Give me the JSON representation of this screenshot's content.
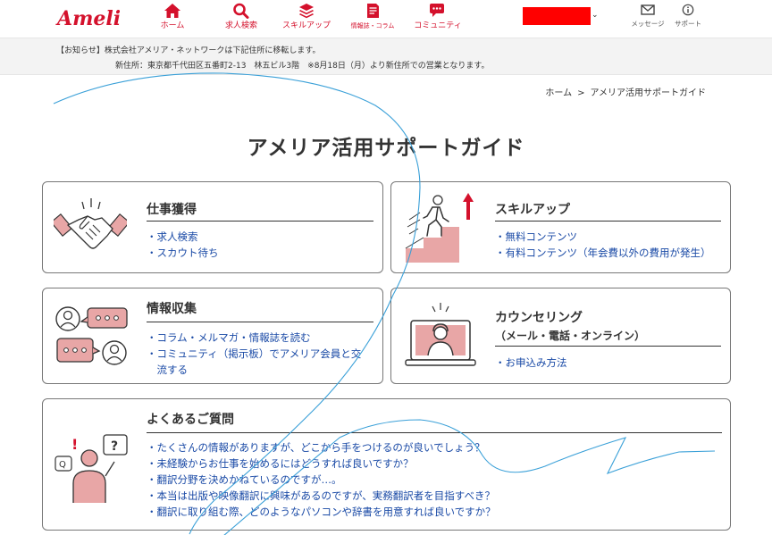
{
  "header": {
    "logo_text": "Amelia",
    "nav": [
      {
        "label": "ホーム",
        "icon": "home-icon"
      },
      {
        "label": "求人検索",
        "icon": "search-icon"
      },
      {
        "label": "スキルアップ",
        "icon": "layers-icon"
      },
      {
        "label": "情報誌・コラム",
        "icon": "document-icon"
      },
      {
        "label": "コミュニティ",
        "icon": "chat-icon"
      }
    ],
    "util": [
      {
        "label": "メッセージ",
        "icon": "envelope-icon"
      },
      {
        "label": "サポート",
        "icon": "info-icon"
      }
    ],
    "user_chevron": "⌄"
  },
  "notice": {
    "line1": "【お知らせ】株式会社アメリア・ネットワークは下記住所に移転します。",
    "line2": "新住所：東京都千代田区五番町2-13　林五ビル3階　※8月18日（月）より新住所での営業となります。"
  },
  "breadcrumb": {
    "home": "ホーム",
    "sep": ">",
    "current": "アメリア活用サポートガイド"
  },
  "page_title": "アメリア活用サポートガイド",
  "cards": {
    "job": {
      "heading": "仕事獲得",
      "icon": "handshake-icon",
      "links": [
        "・求人検索",
        "・スカウト待ち"
      ]
    },
    "skill": {
      "heading": "スキルアップ",
      "icon": "stairs-climb-icon",
      "links": [
        "・無料コンテンツ",
        "・有料コンテンツ（年会費以外の費用が発生）"
      ]
    },
    "info": {
      "heading": "情報収集",
      "icon": "conversation-icon",
      "links": [
        "・コラム・メルマガ・情報誌を読む",
        "・コミュニティ（掲示板）でアメリア会員と交",
        "　流する"
      ]
    },
    "counsel": {
      "heading": "カウンセリング",
      "sub": "（メール・電話・オンライン）",
      "icon": "online-counseling-icon",
      "links": [
        "・お申込み方法"
      ]
    },
    "faq": {
      "heading": "よくあるご質問",
      "icon": "question-person-icon",
      "links": [
        "・たくさんの情報がありますが、どこから手をつけるのが良いでしょう？",
        "・未経験からお仕事を始めるにはどうすれば良いですか？",
        "・翻訳分野を決めかねているのですが…。",
        "・本当は出版や映像翻訳に興味があるのですが、実務翻訳者を目指すべき？",
        "・翻訳に取り組む際、どのようなパソコンや辞書を用意すれば良いですか？"
      ]
    }
  },
  "colors": {
    "brand_red": "#d4112c",
    "link_blue": "#1a4aa6",
    "icon_pink": "#e8a6a6",
    "scribble_blue": "#3aa0d8"
  }
}
